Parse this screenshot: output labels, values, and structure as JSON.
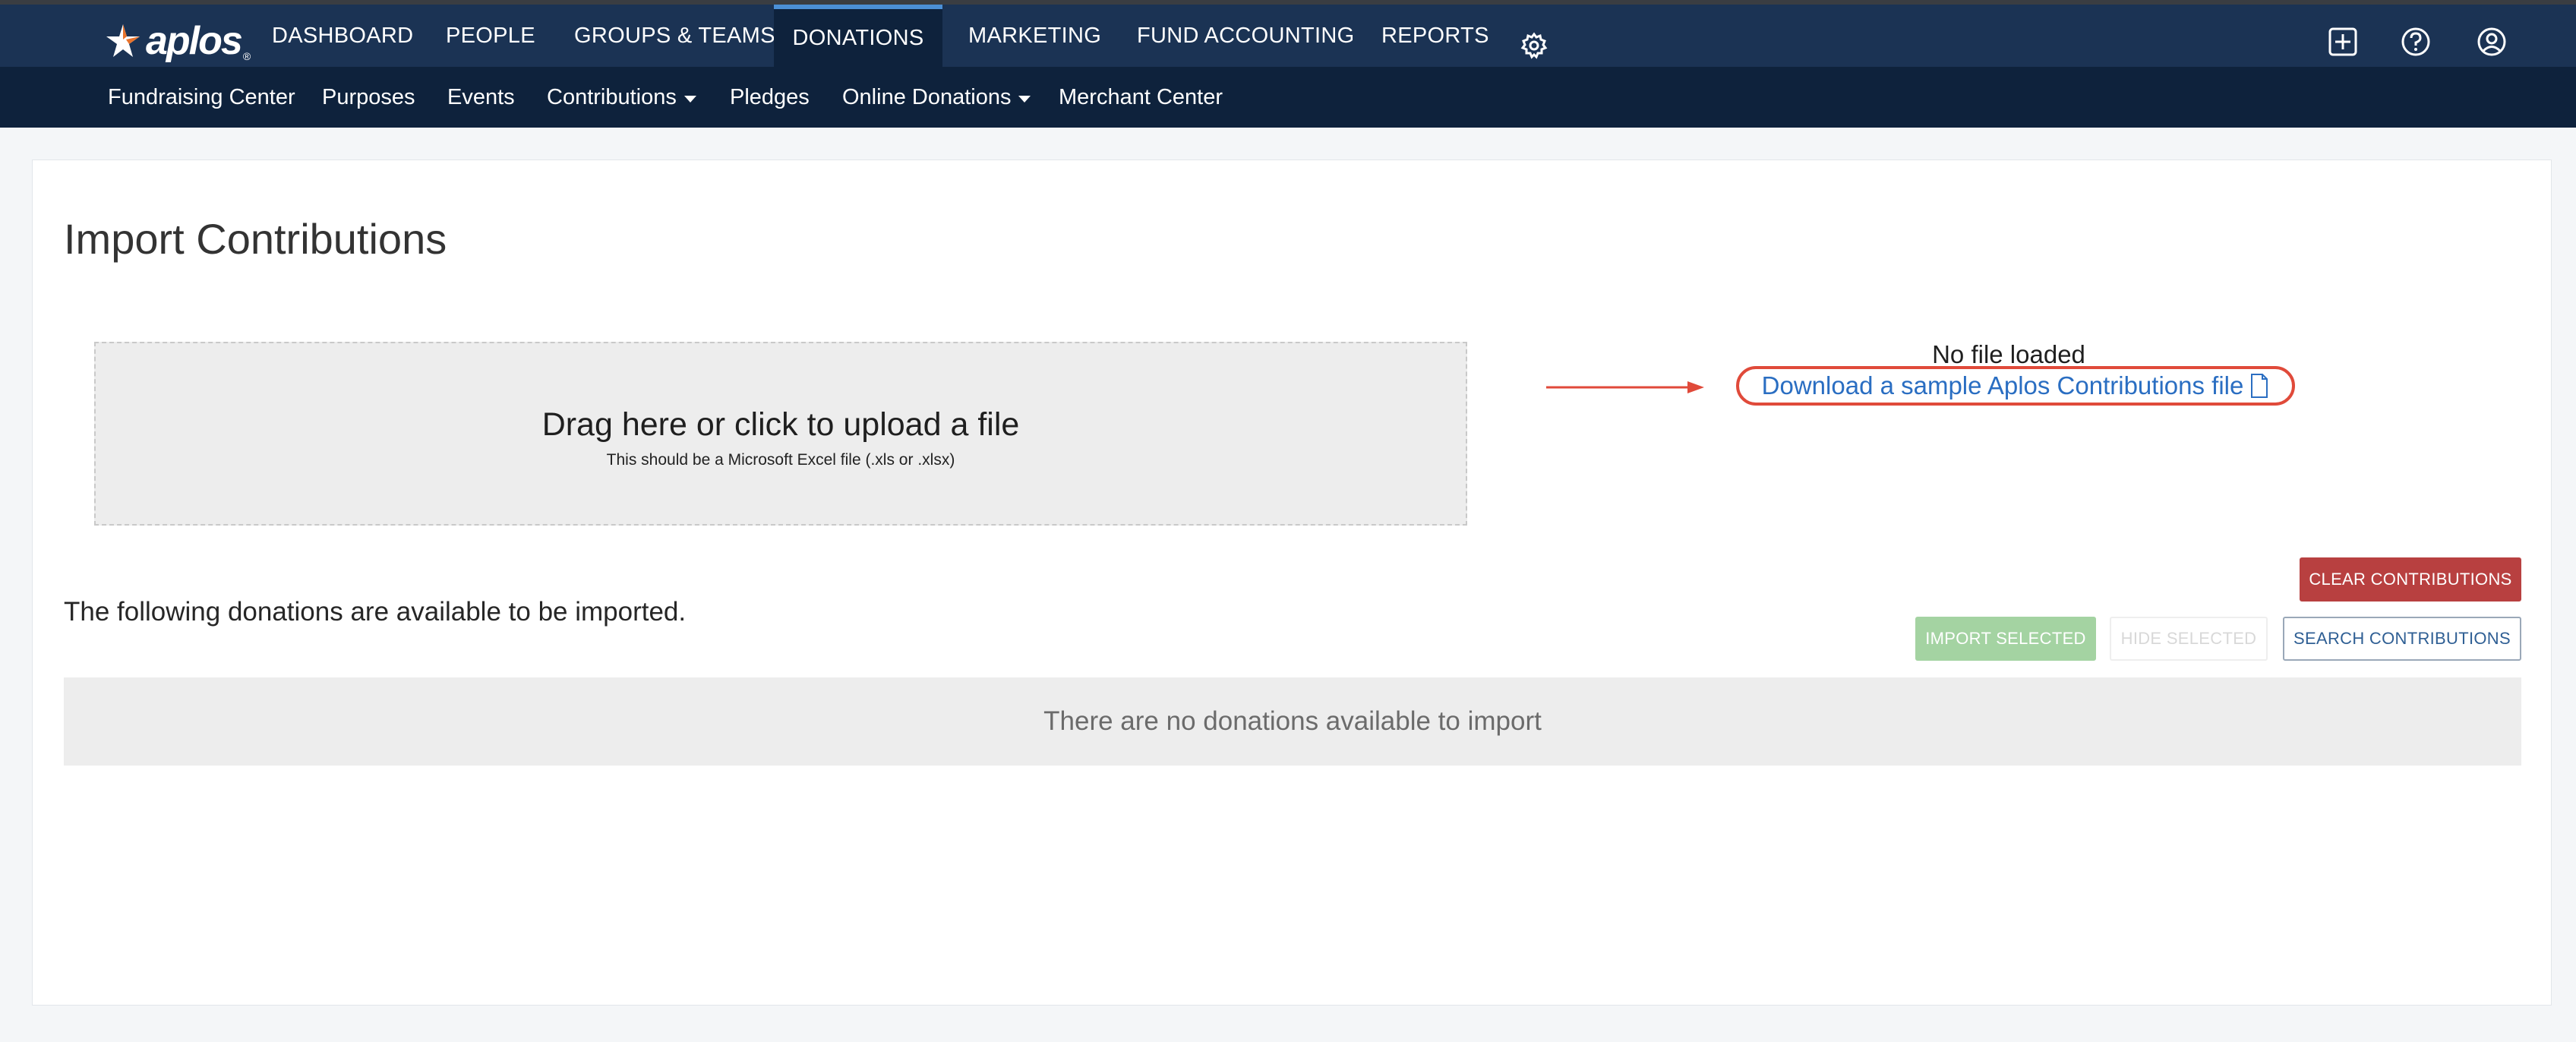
{
  "brand": {
    "logo_text": "aplos",
    "logo_reg": "®"
  },
  "topnav": {
    "items": [
      {
        "label": "DASHBOARD"
      },
      {
        "label": "PEOPLE"
      },
      {
        "label": "GROUPS & TEAMS"
      },
      {
        "label": "DONATIONS",
        "active": true
      },
      {
        "label": "MARKETING"
      },
      {
        "label": "FUND ACCOUNTING"
      },
      {
        "label": "REPORTS"
      }
    ],
    "icons": [
      "gear-icon",
      "add-square-icon",
      "help-circle-icon",
      "user-circle-icon"
    ]
  },
  "subnav": {
    "items": [
      {
        "label": "Fundraising Center"
      },
      {
        "label": "Purposes"
      },
      {
        "label": "Events"
      },
      {
        "label": "Contributions",
        "dropdown": true
      },
      {
        "label": "Pledges"
      },
      {
        "label": "Online Donations",
        "dropdown": true
      },
      {
        "label": "Merchant Center"
      }
    ]
  },
  "page": {
    "title": "Import Contributions",
    "dropzone": {
      "title": "Drag here or click to upload a file",
      "subtitle": "This should be a Microsoft Excel file (.xls or .xlsx)"
    },
    "file_status": "No file loaded",
    "download_link": "Download a sample Aplos Contributions file",
    "available_text": "The following donations are available to be imported.",
    "buttons": {
      "clear": "CLEAR CONTRIBUTIONS",
      "import_selected": "IMPORT SELECTED",
      "hide_selected": "HIDE SELECTED",
      "search": "SEARCH CONTRIBUTIONS"
    },
    "empty_message": "There are no donations available to import"
  },
  "colors": {
    "topnav_bg": "#1b3354",
    "subnav_bg": "#0e223c",
    "active_accent": "#4b8fd6",
    "link": "#2a6ec2",
    "annotation_red": "#e04a3a",
    "clear_button": "#b84040",
    "import_button": "#a4d3a2"
  }
}
